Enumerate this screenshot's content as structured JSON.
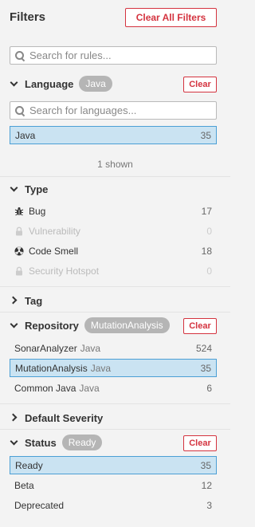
{
  "header": {
    "title": "Filters",
    "clear_all": "Clear All Filters"
  },
  "rules_search": {
    "placeholder": "Search for rules..."
  },
  "language": {
    "title": "Language",
    "badge": "Java",
    "clear": "Clear",
    "search_placeholder": "Search for languages...",
    "items": [
      {
        "label": "Java",
        "count": "35",
        "selected": true
      }
    ],
    "shown_text": "1 shown"
  },
  "type": {
    "title": "Type",
    "items": [
      {
        "label": "Bug",
        "count": "17",
        "icon": "bug-icon"
      },
      {
        "label": "Vulnerability",
        "count": "0",
        "icon": "lock-icon"
      },
      {
        "label": "Code Smell",
        "count": "18",
        "icon": "code-smell-icon"
      },
      {
        "label": "Security Hotspot",
        "count": "0",
        "icon": "lock-icon"
      }
    ]
  },
  "tag": {
    "title": "Tag"
  },
  "repository": {
    "title": "Repository",
    "badge": "MutationAnalysis",
    "clear": "Clear",
    "items": [
      {
        "label": "SonarAnalyzer",
        "sub": "Java",
        "count": "524"
      },
      {
        "label": "MutationAnalysis",
        "sub": "Java",
        "count": "35",
        "selected": true
      },
      {
        "label": "Common Java",
        "sub": "Java",
        "count": "6"
      }
    ]
  },
  "severity": {
    "title": "Default Severity"
  },
  "status": {
    "title": "Status",
    "badge": "Ready",
    "clear": "Clear",
    "items": [
      {
        "label": "Ready",
        "count": "35",
        "selected": true
      },
      {
        "label": "Beta",
        "count": "12"
      },
      {
        "label": "Deprecated",
        "count": "3"
      }
    ]
  },
  "colors": {
    "accent_red": "#d4333f",
    "selected_bg": "#cae3f2",
    "selected_border": "#4b9fd5",
    "badge_bg": "#b5b5b5"
  }
}
